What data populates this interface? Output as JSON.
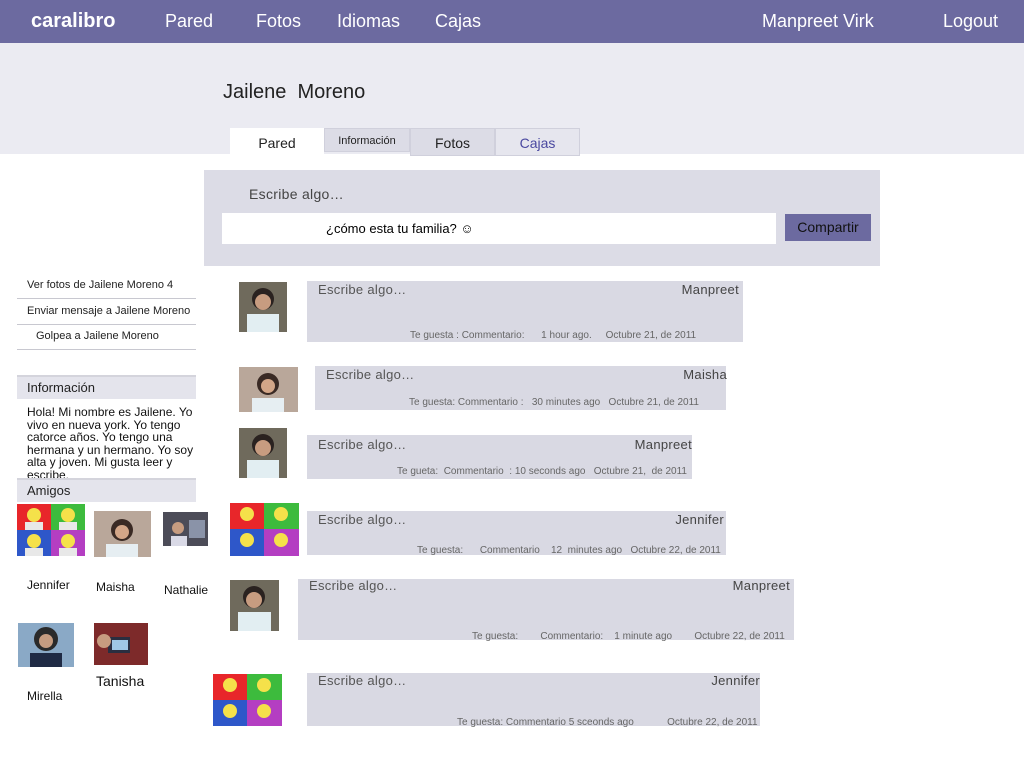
{
  "nav": {
    "brand": "caralibro",
    "wall": "Pared",
    "photos": "Fotos",
    "languages": "Idiomas",
    "boxes": "Cajas",
    "user": "Manpreet Virk",
    "logout": "Logout"
  },
  "profile": {
    "name": "Jailene  Moreno",
    "tabs": [
      "Pared",
      "Información",
      "Fotos",
      "Cajas"
    ]
  },
  "composer": {
    "prompt": "Escribe algo…",
    "value": "¿cómo esta tu familia? ☺",
    "share": "Compartir"
  },
  "sidebar": {
    "links": [
      "Ver fotos de Jailene Moreno 4",
      "Enviar mensaje a Jailene Moreno",
      "Golpea a Jailene Moreno"
    ],
    "info_title": "Información",
    "about": "Hola! Mi nombre es Jailene. Yo vivo en nueva york. Yo tengo catorce años. Yo tengo una hermana y un hermano. Yo soy alta y joven. Mi gusta leer y escribe.",
    "friends_title": "Amigos",
    "friends": [
      "Jennifer",
      "Maisha",
      "Nathalie",
      "Mirella",
      "Tanisha"
    ]
  },
  "posts": [
    {
      "prompt": "Escribe algo…",
      "author": "Manpreet",
      "meta": "Te guesta : Commentario:      1 hour ago.     Octubre 21, de 2011"
    },
    {
      "prompt": "Escribe algo…",
      "author": "Maisha",
      "meta": "Te guesta: Commentario :   30 minutes ago   Octubre 21, de 2011"
    },
    {
      "prompt": "Escribe algo…",
      "author": "Manpreet",
      "meta": "Te gueta:  Commentario  : 10 seconds ago   Octubre 21,  de 2011"
    },
    {
      "prompt": "Escribe algo…",
      "author": "Jennifer",
      "meta": "Te guesta:      Commentario    12  minutes ago   Octubre 22, de 2011"
    },
    {
      "prompt": "Escribe algo…",
      "author": "Manpreet",
      "meta": "Te guesta:        Commentario:    1 minute ago        Octubre 22, de 2011"
    },
    {
      "prompt": "Escribe algo…",
      "author": "Jennifer",
      "meta": "Te guesta: Commentario 5 sceonds ago            Octubre 22, de 2011"
    }
  ],
  "colors": {
    "topbar": "#6c6aa0",
    "header_band": "#ebebf2",
    "panel": "#dcdce6",
    "post_bg": "#d9d9e3",
    "tab_active_bg": "#ffffff",
    "tab_inactive_bg": "#dcdce6",
    "tab_link": "#4a48a0"
  }
}
